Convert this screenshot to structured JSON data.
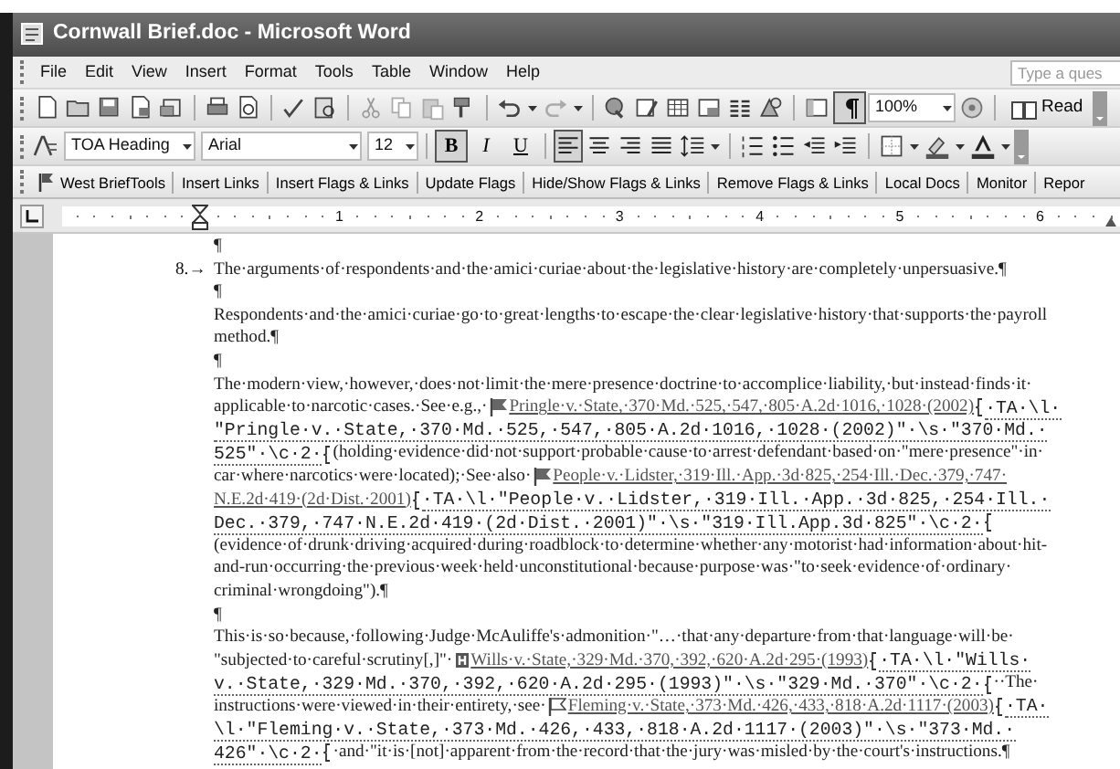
{
  "window": {
    "title": "Cornwall Brief.doc - Microsoft Word"
  },
  "menu": [
    "File",
    "Edit",
    "View",
    "Insert",
    "Format",
    "Tools",
    "Table",
    "Window",
    "Help"
  ],
  "help_box": {
    "placeholder": "Type a ques"
  },
  "standard_toolbar": {
    "show_formatting": true,
    "zoom": "100%",
    "read_button": "Read"
  },
  "formatting_toolbar": {
    "style": "TOA Heading",
    "font": "Arial",
    "size": "12",
    "alignments": [
      {
        "selected": true
      },
      {
        "selected": false
      },
      {
        "selected": false
      },
      {
        "selected": false
      }
    ],
    "toggles": [
      {
        "label": "B",
        "pressed": true
      },
      {
        "label": "I",
        "pressed": false
      },
      {
        "label": "U",
        "pressed": false
      }
    ]
  },
  "brief_toolbar": {
    "items": [
      "West BriefTools",
      "Insert Links",
      "Insert Flags & Links",
      "Update Flags",
      "Hide/Show Flags & Links",
      "Remove Flags & Links",
      "Local Docs",
      "Monitor",
      "Repor"
    ]
  },
  "ruler": {
    "labels": [
      "1",
      "2",
      "3",
      "4",
      "5",
      "6"
    ]
  },
  "document": {
    "lines": [
      {
        "runs": [
          {
            "kind": "text",
            "text": "¶"
          }
        ]
      },
      {
        "runs": [
          {
            "kind": "number",
            "text": "8.→"
          },
          {
            "kind": "text",
            "text": "The·arguments·of·respondents·and·the·amici·curiae·about·the·legislative·history·are·completely·unpersuasive.¶"
          }
        ]
      },
      {
        "runs": [
          {
            "kind": "text",
            "text": "¶"
          }
        ]
      },
      {
        "runs": [
          {
            "kind": "text",
            "text": "Respondents·and·the·amici·curiae·go·to·great·lengths·to·escape·the·clear·legislative·history·that·supports·the·payroll"
          }
        ]
      },
      {
        "runs": [
          {
            "kind": "text",
            "text": "method.¶"
          }
        ]
      },
      {
        "runs": [
          {
            "kind": "text",
            "text": "¶"
          }
        ]
      },
      {
        "runs": [
          {
            "kind": "text",
            "text": "The·modern·view,·however,·does·not·limit·the·mere·presence·doctrine·to·accomplice·liability,·but·instead·finds·it·"
          }
        ]
      },
      {
        "runs": [
          {
            "kind": "text",
            "text": "applicable·to·narcotic·cases.·See·e.g.,·"
          },
          {
            "kind": "flag"
          },
          {
            "kind": "cite",
            "text": "Pringle·v.·State,·370·Md.·525,·547,·805·A.2d·1016,·1028·(2002)"
          },
          {
            "kind": "field-mark"
          },
          {
            "kind": "code",
            "text": "·TA·\\l·"
          }
        ]
      },
      {
        "runs": [
          {
            "kind": "code",
            "text": "\"Pringle·v.·State,·370·Md.·525,·547,·805·A.2d·1016,·1028·(2002)\"·\\s·\"370·Md.·"
          }
        ]
      },
      {
        "runs": [
          {
            "kind": "code",
            "text": "525\"·\\c·2·"
          },
          {
            "kind": "field-mark"
          },
          {
            "kind": "text",
            "text": "(holding·evidence·did·not·support·probable·cause·to·arrest·defendant·based·on·\"mere·presence\"·in·"
          }
        ]
      },
      {
        "runs": [
          {
            "kind": "text",
            "text": "car·where·narcotics·were·located);·See·also·"
          },
          {
            "kind": "flag"
          },
          {
            "kind": "cite",
            "text": "People·v.·Lidster,·319·Ill.·App.·3d·825,·254·Ill.·Dec.·379,·747·"
          }
        ]
      },
      {
        "runs": [
          {
            "kind": "cite",
            "text": "N.E.2d·419·(2d·Dist.·2001)"
          },
          {
            "kind": "field-mark"
          },
          {
            "kind": "code",
            "text": "·TA·\\l·\"People·v.·Lidster,·319·Ill.·App.·3d·825,·254·Ill.·"
          }
        ]
      },
      {
        "runs": [
          {
            "kind": "code",
            "text": "Dec.·379,·747·N.E.2d·419·(2d·Dist.·2001)\"·\\s·\"319·Ill.App.3d·825\"·\\c·2·"
          },
          {
            "kind": "field-mark"
          }
        ]
      },
      {
        "runs": [
          {
            "kind": "text",
            "text": "(evidence·of·drunk·driving·acquired·during·roadblock·to·determine·whether·any·motorist·had·information·about·hit-"
          }
        ]
      },
      {
        "runs": [
          {
            "kind": "text",
            "text": "and-run·occurring·the·previous·week·held·unconstitutional·because·purpose·was·\"to·seek·evidence·of·ordinary·"
          }
        ]
      },
      {
        "runs": [
          {
            "kind": "text",
            "text": "criminal·wrongdoing\").¶"
          }
        ]
      },
      {
        "runs": [
          {
            "kind": "text",
            "text": "¶"
          }
        ]
      },
      {
        "runs": [
          {
            "kind": "text",
            "text": "This·is·so·because,·following·Judge·McAuliffe's·admonition·\"…·that·any·departure·from·that·language·will·be·"
          }
        ]
      },
      {
        "runs": [
          {
            "kind": "text",
            "text": "\"subjected·to·careful·scrutiny[,]\"·"
          },
          {
            "kind": "h-flag"
          },
          {
            "kind": "cite",
            "text": "Wills·v.·State,·329·Md.·370,·392,·620·A.2d·295·(1993)"
          },
          {
            "kind": "field-mark"
          },
          {
            "kind": "code",
            "text": "·TA·\\l·\"Wills·"
          }
        ]
      },
      {
        "runs": [
          {
            "kind": "code",
            "text": "v.·State,·329·Md.·370,·392,·620·A.2d·295·(1993)\"·\\s·\"329·Md.·370\"·\\c·2·"
          },
          {
            "kind": "field-mark"
          },
          {
            "kind": "text",
            "text": "··The·"
          }
        ]
      },
      {
        "runs": [
          {
            "kind": "text",
            "text": "instructions·were·viewed·in·their·entirety,·see·"
          },
          {
            "kind": "flag-outline"
          },
          {
            "kind": "cite",
            "text": "Fleming·v.·State,·373·Md.·426,·433,·818·A.2d·1117·(2003)"
          },
          {
            "kind": "field-mark"
          },
          {
            "kind": "code",
            "text": "·TA·"
          }
        ]
      },
      {
        "runs": [
          {
            "kind": "code",
            "text": "\\l·\"Fleming·v.·State,·373·Md.·426,·433,·818·A.2d·1117·(2003)\"·\\s·\"373·Md.·"
          }
        ]
      },
      {
        "runs": [
          {
            "kind": "code",
            "text": "426\"·\\c·2·"
          },
          {
            "kind": "field-mark"
          },
          {
            "kind": "text",
            "text": "·and·\"it·is·[not]·apparent·from·the·record·that·the·jury·was·misled·by·the·court's·instructions.¶"
          }
        ]
      }
    ]
  }
}
